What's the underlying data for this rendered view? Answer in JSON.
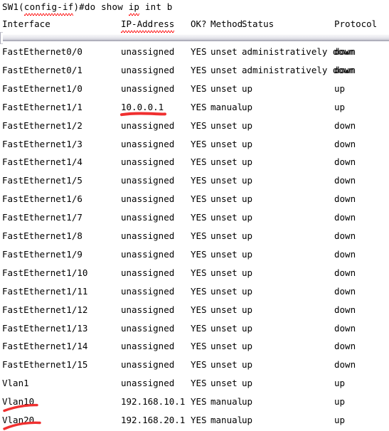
{
  "terminal": {
    "prompt_line": {
      "host_mode": "SW1(config-if)#",
      "host_prefix": "SW1(",
      "misspelled_1": "config-if",
      "host_suffix": ")#do show ",
      "misspelled_2": "ip",
      "tail": " int b",
      "full_text": "SW1(config-if)#do show ip int b"
    }
  },
  "table": {
    "headers": {
      "interface": "Interface",
      "ip_address": "IP-Address",
      "ok": "OK?",
      "method": "Method",
      "status": "Status",
      "protocol": "Protocol"
    },
    "rows": [
      {
        "interface": "FastEthernet0/0",
        "ip_address": "unassigned",
        "ok": "YES",
        "method": "unset",
        "status": "administratively down",
        "protocol": "down"
      },
      {
        "interface": "FastEthernet0/1",
        "ip_address": "unassigned",
        "ok": "YES",
        "method": "unset",
        "status": "administratively down",
        "protocol": "down"
      },
      {
        "interface": "FastEthernet1/0",
        "ip_address": "unassigned",
        "ok": "YES",
        "method": "unset",
        "status": "up",
        "protocol": "up"
      },
      {
        "interface": "FastEthernet1/1",
        "ip_address": "10.0.0.1",
        "ok": "YES",
        "method": "manual",
        "status": "up",
        "protocol": "up"
      },
      {
        "interface": "FastEthernet1/2",
        "ip_address": "unassigned",
        "ok": "YES",
        "method": "unset",
        "status": "up",
        "protocol": "down"
      },
      {
        "interface": "FastEthernet1/3",
        "ip_address": "unassigned",
        "ok": "YES",
        "method": "unset",
        "status": "up",
        "protocol": "down"
      },
      {
        "interface": "FastEthernet1/4",
        "ip_address": "unassigned",
        "ok": "YES",
        "method": "unset",
        "status": "up",
        "protocol": "down"
      },
      {
        "interface": "FastEthernet1/5",
        "ip_address": "unassigned",
        "ok": "YES",
        "method": "unset",
        "status": "up",
        "protocol": "down"
      },
      {
        "interface": "FastEthernet1/6",
        "ip_address": "unassigned",
        "ok": "YES",
        "method": "unset",
        "status": "up",
        "protocol": "down"
      },
      {
        "interface": "FastEthernet1/7",
        "ip_address": "unassigned",
        "ok": "YES",
        "method": "unset",
        "status": "up",
        "protocol": "down"
      },
      {
        "interface": "FastEthernet1/8",
        "ip_address": "unassigned",
        "ok": "YES",
        "method": "unset",
        "status": "up",
        "protocol": "down"
      },
      {
        "interface": "FastEthernet1/9",
        "ip_address": "unassigned",
        "ok": "YES",
        "method": "unset",
        "status": "up",
        "protocol": "down"
      },
      {
        "interface": "FastEthernet1/10",
        "ip_address": "unassigned",
        "ok": "YES",
        "method": "unset",
        "status": "up",
        "protocol": "down"
      },
      {
        "interface": "FastEthernet1/11",
        "ip_address": "unassigned",
        "ok": "YES",
        "method": "unset",
        "status": "up",
        "protocol": "down"
      },
      {
        "interface": "FastEthernet1/12",
        "ip_address": "unassigned",
        "ok": "YES",
        "method": "unset",
        "status": "up",
        "protocol": "down"
      },
      {
        "interface": "FastEthernet1/13",
        "ip_address": "unassigned",
        "ok": "YES",
        "method": "unset",
        "status": "up",
        "protocol": "down"
      },
      {
        "interface": "FastEthernet1/14",
        "ip_address": "unassigned",
        "ok": "YES",
        "method": "unset",
        "status": "up",
        "protocol": "down"
      },
      {
        "interface": "FastEthernet1/15",
        "ip_address": "unassigned",
        "ok": "YES",
        "method": "unset",
        "status": "up",
        "protocol": "down"
      },
      {
        "interface": "Vlan1",
        "ip_address": "unassigned",
        "ok": "YES",
        "method": "unset",
        "status": "up",
        "protocol": "up"
      },
      {
        "interface": "Vlan10",
        "ip_address": "192.168.10.1",
        "ok": "YES",
        "method": "manual",
        "status": "up",
        "protocol": "up"
      },
      {
        "interface": "Vlan20",
        "ip_address": "192.168.20.1",
        "ok": "YES",
        "method": "manual",
        "status": "up",
        "protocol": "up"
      }
    ]
  },
  "annotations": {
    "color": "#f03030",
    "items": [
      {
        "name": "ip-address-underline",
        "target": "10.0.0.1"
      },
      {
        "name": "vlan10-underline",
        "target": "Vlan10"
      },
      {
        "name": "vlan20-underline",
        "target": "Vlan20"
      }
    ]
  },
  "colors": {
    "background": "#ffffff",
    "text": "#000000",
    "annotation_red": "#f03030",
    "spellcheck_red": "#ff0000",
    "separator_gray": "#a9a9b6"
  }
}
